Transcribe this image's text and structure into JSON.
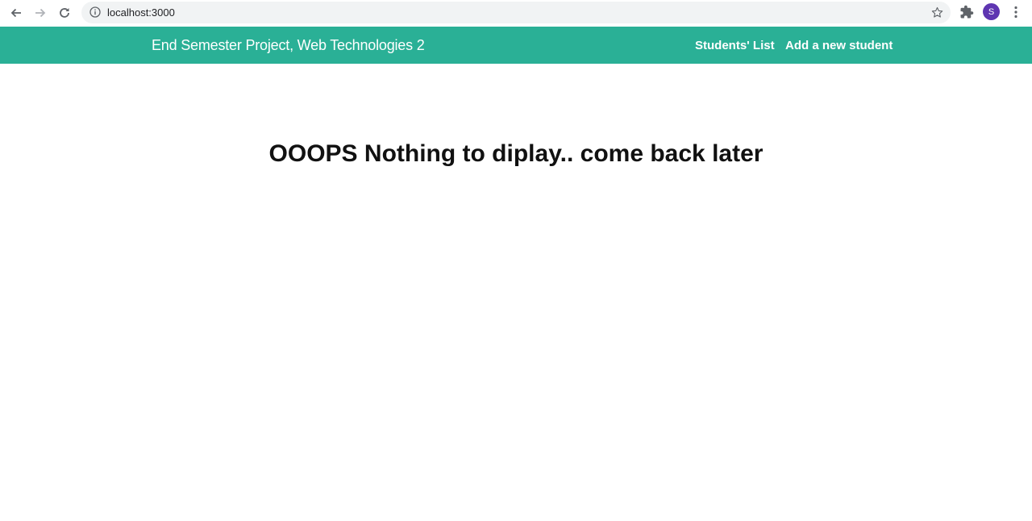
{
  "browser": {
    "url": "localhost:3000",
    "profile_initial": "S",
    "colors": {
      "omnibox_bg": "#f1f3f4",
      "avatar_bg": "#5e35b1"
    }
  },
  "navbar": {
    "brand": "End Semester Project, Web Technologies 2",
    "links": [
      "Students' List",
      "Add a new student"
    ],
    "color": "#2ab096"
  },
  "main": {
    "message": "OOOPS Nothing to diplay.. come back later"
  }
}
